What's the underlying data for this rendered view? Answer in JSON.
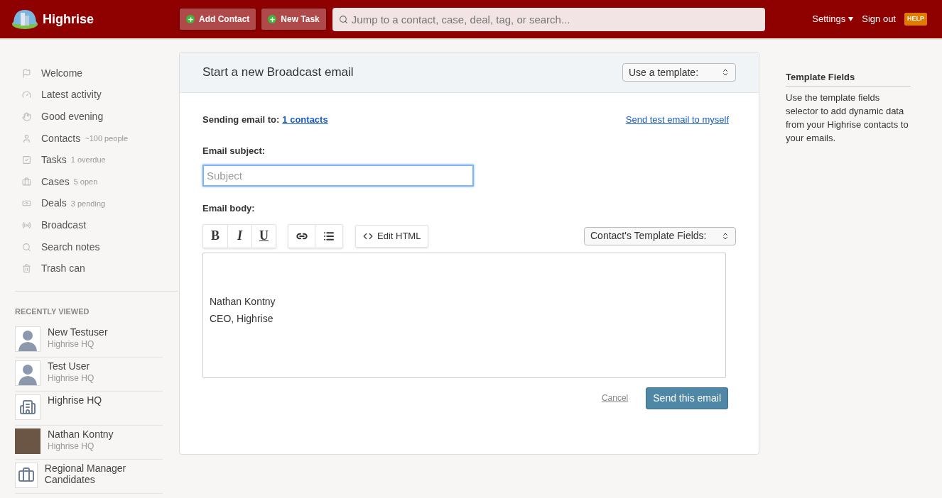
{
  "header": {
    "logo": "Highrise",
    "buttons": [
      "Add Contact",
      "New Task"
    ],
    "search": {
      "placeholder": "Jump to a contact, case, deal, tag, or search..."
    },
    "settings": "Settings",
    "sign_out": "Sign out",
    "help": "HELP"
  },
  "sidebar": {
    "items": [
      {
        "kind": "flag",
        "label": "Welcome"
      },
      {
        "kind": "gauge",
        "label": "Latest activity"
      },
      {
        "kind": "hand",
        "label": "Good evening"
      },
      {
        "kind": "person",
        "label": "Contacts",
        "note": "~100 people"
      },
      {
        "kind": "task",
        "label": "Tasks",
        "note": "1 overdue"
      },
      {
        "kind": "case",
        "label": "Cases",
        "note": "5 open"
      },
      {
        "kind": "deal",
        "label": "Deals",
        "note": "3 pending"
      },
      {
        "kind": "broadcast",
        "label": "Broadcast"
      },
      {
        "kind": "search",
        "label": "Search notes"
      },
      {
        "kind": "trash",
        "label": "Trash can"
      }
    ],
    "recently_viewed": {
      "title": "RECENTLY VIEWED",
      "items": [
        {
          "kind": "person",
          "name": "New Testuser",
          "company": "Highrise HQ"
        },
        {
          "kind": "person",
          "name": "Test User",
          "company": "Highrise HQ"
        },
        {
          "kind": "company",
          "name": "Highrise HQ"
        },
        {
          "kind": "photo",
          "name": "Nathan Kontny",
          "company": "Highrise HQ"
        },
        {
          "kind": "case",
          "name": "Regional Manager Candidates"
        }
      ]
    }
  },
  "composer": {
    "title": "Start a new Broadcast email",
    "template_select": "Use a template:",
    "sending_label": "Sending email to:",
    "recipients_link": "1 contacts",
    "test_link": "Send test email to myself",
    "subject_label": "Email subject:",
    "subject": {
      "placeholder": "Subject",
      "focused": true
    },
    "body_label": "Email body:",
    "format_buttons": [
      "B",
      "I",
      "U"
    ],
    "edit_html": "Edit HTML",
    "fields_select": "Contact's Template Fields:",
    "body_lines": [
      "Nathan Kontny",
      "CEO, Highrise"
    ],
    "cancel": "Cancel",
    "send": "Send this email"
  },
  "help_panel": {
    "title": "Template Fields",
    "text": "Use the template fields selector to add dynamic data from your Highrise contacts to your emails."
  }
}
